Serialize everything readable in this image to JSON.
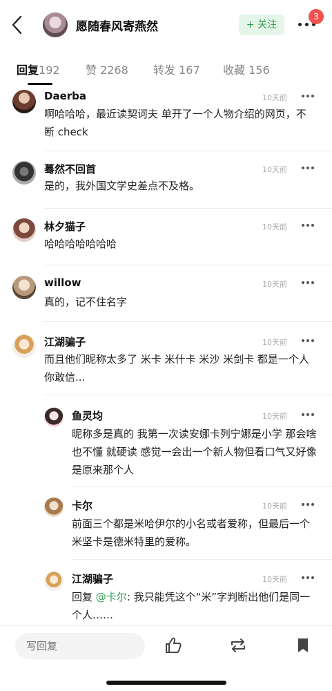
{
  "header": {
    "username": "愿随春风寄燕然",
    "follow_label": "+ 关注",
    "notification_count": "3"
  },
  "tabs": [
    {
      "label": "回复",
      "count": "192",
      "active": true
    },
    {
      "label": "赞",
      "count": "2268",
      "active": false
    },
    {
      "label": "转发",
      "count": "167",
      "active": false
    },
    {
      "label": "收藏",
      "count": "156",
      "active": false
    }
  ],
  "comments": [
    {
      "name": "Daerba",
      "time": "10天前",
      "text": "啊哈哈哈，最近读契诃夫 单开了一个人物介绍的网页，不断 check"
    },
    {
      "name": "蓦然不回首",
      "time": "10天前",
      "text": "是的，我外国文学史差点不及格。"
    },
    {
      "name": "林夕猫子",
      "time": "10天前",
      "text": "哈哈哈哈哈哈哈"
    },
    {
      "name": "willow",
      "time": "10天前",
      "text": "真的，记不住名字"
    },
    {
      "name": "江湖骗子",
      "time": "10天前",
      "text": "而且他们昵称太多了 米卡 米什卡 米沙 米剑卡 都是一个人你敢信..."
    }
  ],
  "replies": [
    {
      "name": "鱼灵均",
      "time": "10天前",
      "text": "昵称多是真的 我第一次读安娜卡列宁娜是小学 那会啥也不懂 就硬读 感觉一会出一个新人物但看口气又好像是原来那个人"
    },
    {
      "name": "卡尔",
      "time": "10天前",
      "text": "前面三个都是米哈伊尔的小名或者爱称，但最后一个米坚卡是德米特里的爱称。"
    },
    {
      "name": "江湖骗子",
      "time": "10天前",
      "reply_prefix": "回复",
      "mention": "@卡尔",
      "text": ": 我只能凭这个“米”字判断出他们是同一个人……"
    }
  ],
  "bottom_bar": {
    "reply_placeholder": "写回复"
  },
  "icons": {
    "back": "back-arrow-icon",
    "more": "more-dots-icon",
    "like": "thumbs-up-icon",
    "repost": "repost-icon",
    "bookmark": "bookmark-icon"
  },
  "colors": {
    "accent": "#2e9d4d",
    "badge": "#ef5350"
  }
}
